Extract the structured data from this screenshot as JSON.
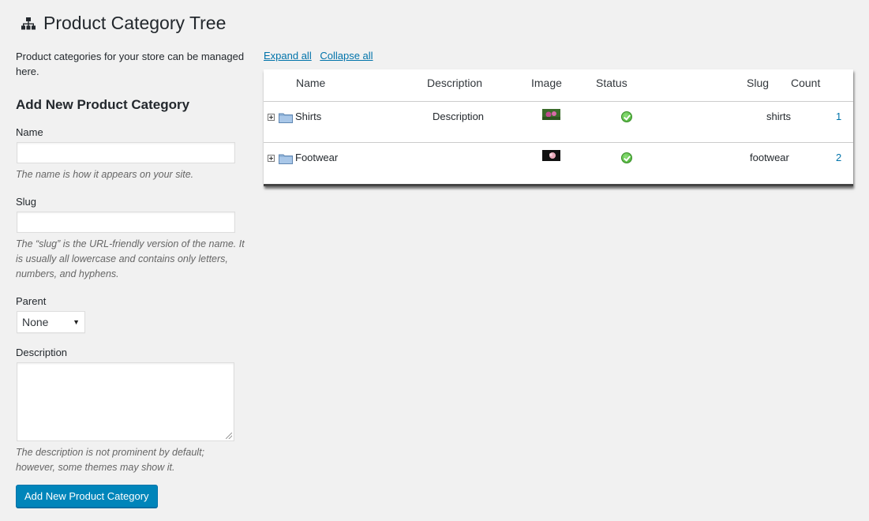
{
  "page": {
    "title": "Product Category Tree",
    "icon": "sitemap-icon"
  },
  "form": {
    "intro": "Product categories for your store can be managed here.",
    "heading": "Add New Product Category",
    "name_label": "Name",
    "name_value": "",
    "name_help": "The name is how it appears on your site.",
    "slug_label": "Slug",
    "slug_value": "",
    "slug_help": "The “slug” is the URL-friendly version of the name. It is usually all lowercase and contains only letters, numbers, and hyphens.",
    "parent_label": "Parent",
    "parent_selected": "None",
    "description_label": "Description",
    "description_value": "",
    "description_help": "The description is not prominent by default; however, some themes may show it.",
    "submit_label": "Add New Product Category"
  },
  "tree": {
    "expand_all": "Expand all",
    "collapse_all": "Collapse all",
    "columns": {
      "name": "Name",
      "description": "Description",
      "image": "Image",
      "status": "Status",
      "slug": "Slug",
      "count": "Count"
    },
    "rows": [
      {
        "name": "Shirts",
        "description": "Description",
        "image": "shirts-thumbnail",
        "status": "active-check-icon",
        "slug": "shirts",
        "count": "1"
      },
      {
        "name": "Footwear",
        "description": "",
        "image": "footwear-thumbnail",
        "status": "active-check-icon",
        "slug": "footwear",
        "count": "2"
      }
    ]
  },
  "colors": {
    "primary_button": "#0085ba",
    "link": "#0073aa",
    "background": "#f1f1f1",
    "status_ok": "#3fa62a"
  }
}
